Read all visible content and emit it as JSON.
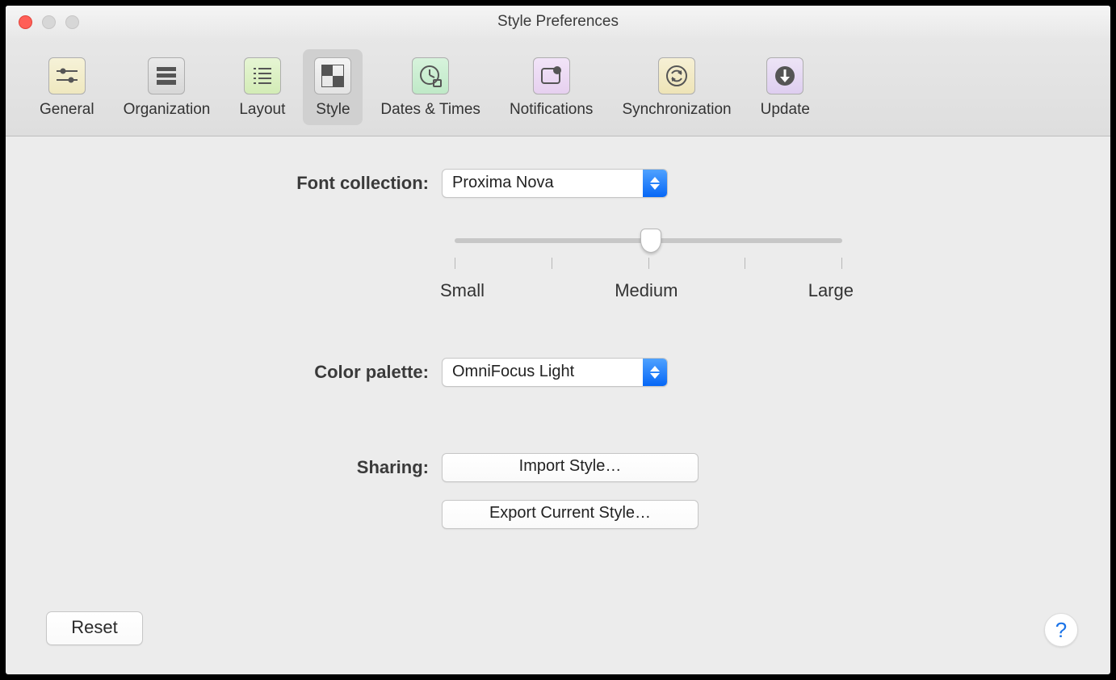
{
  "window": {
    "title": "Style Preferences"
  },
  "tabs": {
    "general": "General",
    "organization": "Organization",
    "layout": "Layout",
    "style": "Style",
    "dates_times": "Dates & Times",
    "notifications": "Notifications",
    "synchronization": "Synchronization",
    "update": "Update"
  },
  "labels": {
    "font_collection": "Font collection:",
    "color_palette": "Color palette:",
    "sharing": "Sharing:"
  },
  "values": {
    "font_collection": "Proxima Nova",
    "color_palette": "OmniFocus Light"
  },
  "slider": {
    "small": "Small",
    "medium": "Medium",
    "large": "Large"
  },
  "buttons": {
    "import_style": "Import Style…",
    "export_style": "Export Current Style…",
    "reset": "Reset",
    "help": "?"
  }
}
